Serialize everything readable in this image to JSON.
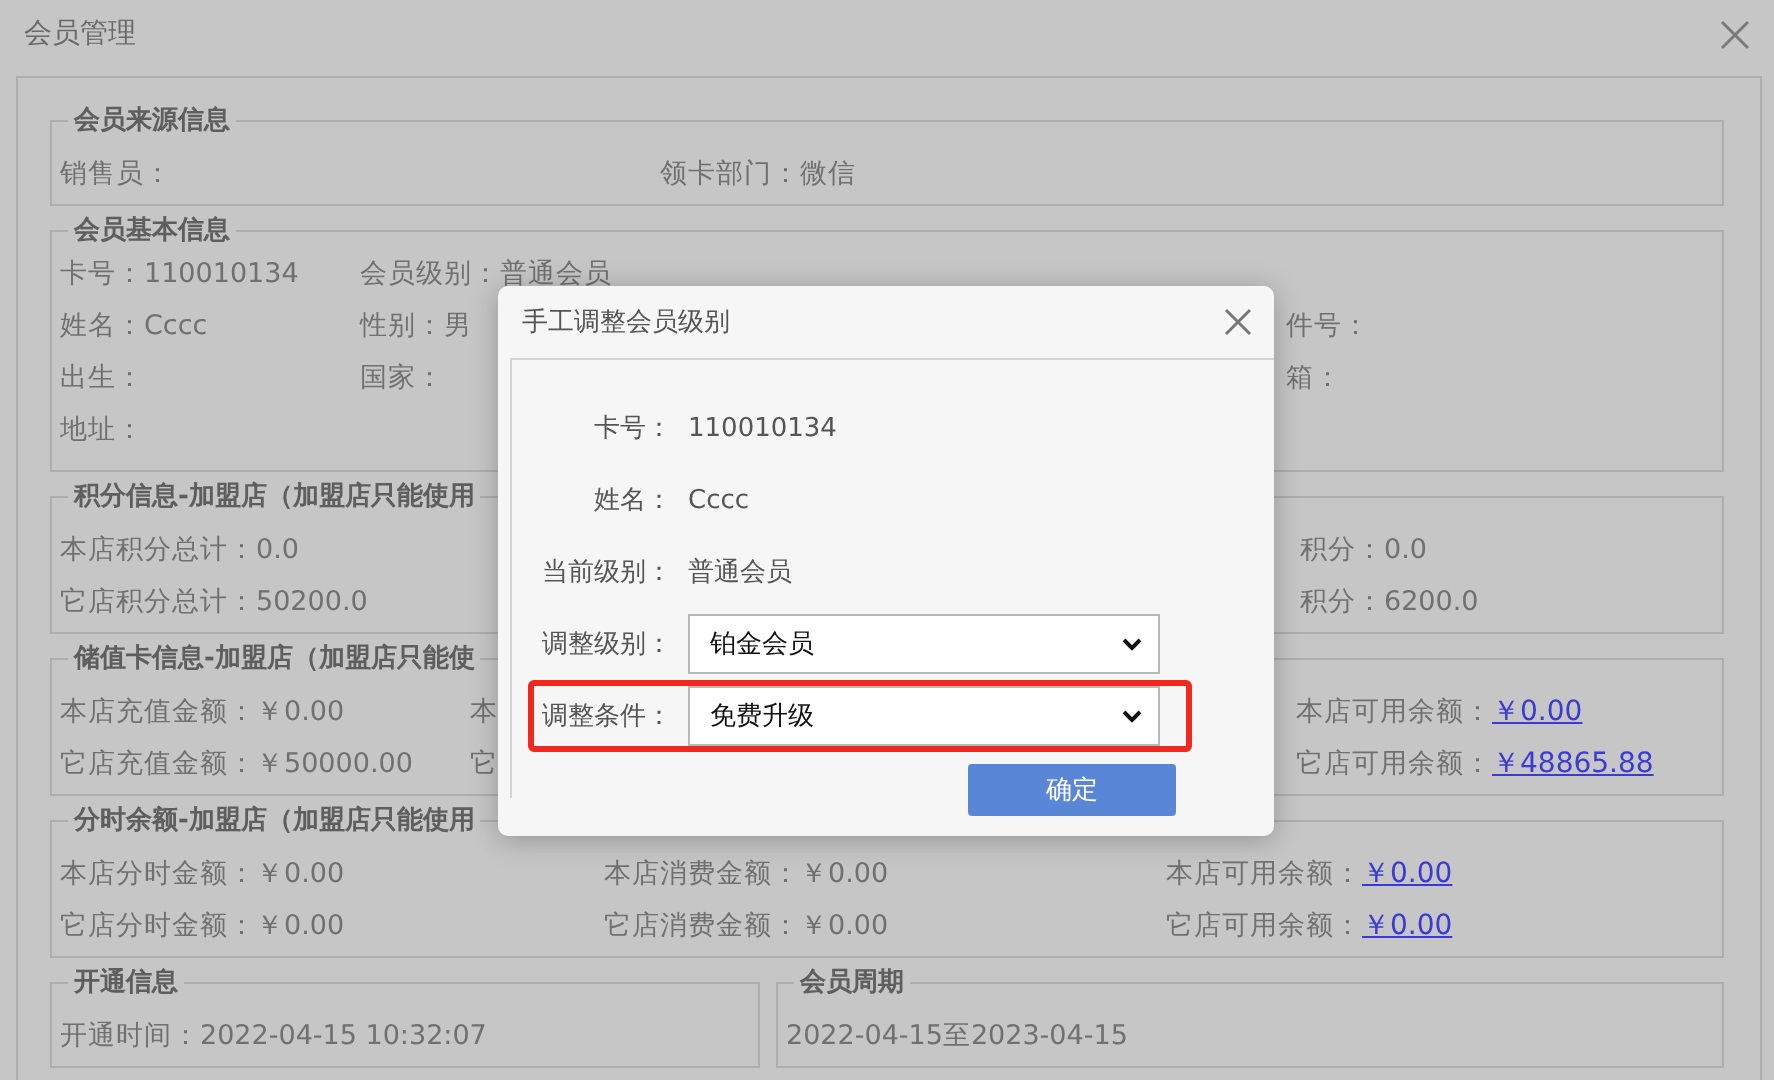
{
  "window": {
    "title": "会员管理"
  },
  "sections": [
    {
      "kind": "source",
      "legend": "会员来源信息",
      "rows": [
        [
          {
            "label": "销售员："
          },
          {
            "label": "领卡部门：",
            "value": "微信"
          }
        ]
      ]
    },
    {
      "kind": "basic",
      "legend": "会员基本信息",
      "rows": [
        [
          {
            "label": "卡号：",
            "value": "110010134"
          },
          {
            "label": "会员级别：",
            "value": "普通会员"
          }
        ],
        [
          {
            "label": "姓名：",
            "value": "Cccc"
          },
          {
            "label": "性别：",
            "value": "男"
          },
          {
            "label": "件号："
          }
        ],
        [
          {
            "label": "出生："
          },
          {
            "label": "国家："
          },
          {
            "label": "箱："
          }
        ],
        [
          {
            "label": "地址："
          }
        ]
      ]
    },
    {
      "kind": "points",
      "legend": "积分信息-加盟店（加盟店只能使用",
      "rows": [
        [
          {
            "label": "本店积分总计：",
            "value": "0.0"
          },
          {
            "label": "积分：",
            "value": "0.0"
          }
        ],
        [
          {
            "label": "它店积分总计：",
            "value": "50200.0"
          },
          {
            "label": "积分：",
            "value": "6200.0"
          }
        ]
      ]
    },
    {
      "kind": "stored",
      "legend": "储值卡信息-加盟店（加盟店只能使",
      "rows": [
        [
          {
            "label": "本店充值金额：",
            "value": "￥0.00"
          },
          {
            "label": "本"
          },
          {
            "label": "本店可用余额：",
            "link_value": "￥0.00"
          }
        ],
        [
          {
            "label": "它店充值金额：",
            "value": "￥50000.00"
          },
          {
            "label": "它"
          },
          {
            "label": "它店可用余额：",
            "link_value": "￥48865.88"
          }
        ]
      ]
    },
    {
      "kind": "timeshare",
      "legend": "分时余额-加盟店（加盟店只能使用",
      "rows": [
        [
          {
            "label": "本店分时金额：",
            "value": "￥0.00"
          },
          {
            "label": "本店消费金额：",
            "value": "￥0.00"
          },
          {
            "label": "本店可用余额：",
            "link_value": "￥0.00"
          }
        ],
        [
          {
            "label": "它店分时金额：",
            "value": "￥0.00"
          },
          {
            "label": "它店消费金额：",
            "value": "￥0.00"
          },
          {
            "label": "它店可用余额：",
            "link_value": "￥0.00"
          }
        ]
      ]
    }
  ],
  "bottom_sections": [
    {
      "legend": "开通信息",
      "text": "开通时间：2022-04-15 10:32:07"
    },
    {
      "legend": "会员周期",
      "text": "2022-04-15至2023-04-15"
    }
  ],
  "dialog": {
    "title": "手工调整会员级别",
    "fields": [
      {
        "kind": "text",
        "label": "卡号：",
        "value": "110010134",
        "highlighted": false
      },
      {
        "kind": "text",
        "label": "姓名：",
        "value": "Cccc",
        "highlighted": false
      },
      {
        "kind": "text",
        "label": "当前级别：",
        "value": "普通会员",
        "highlighted": false
      },
      {
        "kind": "select",
        "label": "调整级别：",
        "value": "铂金会员",
        "highlighted": false
      },
      {
        "kind": "select",
        "label": "调整条件：",
        "value": "免费升级",
        "highlighted": true
      }
    ],
    "button": "确定"
  }
}
